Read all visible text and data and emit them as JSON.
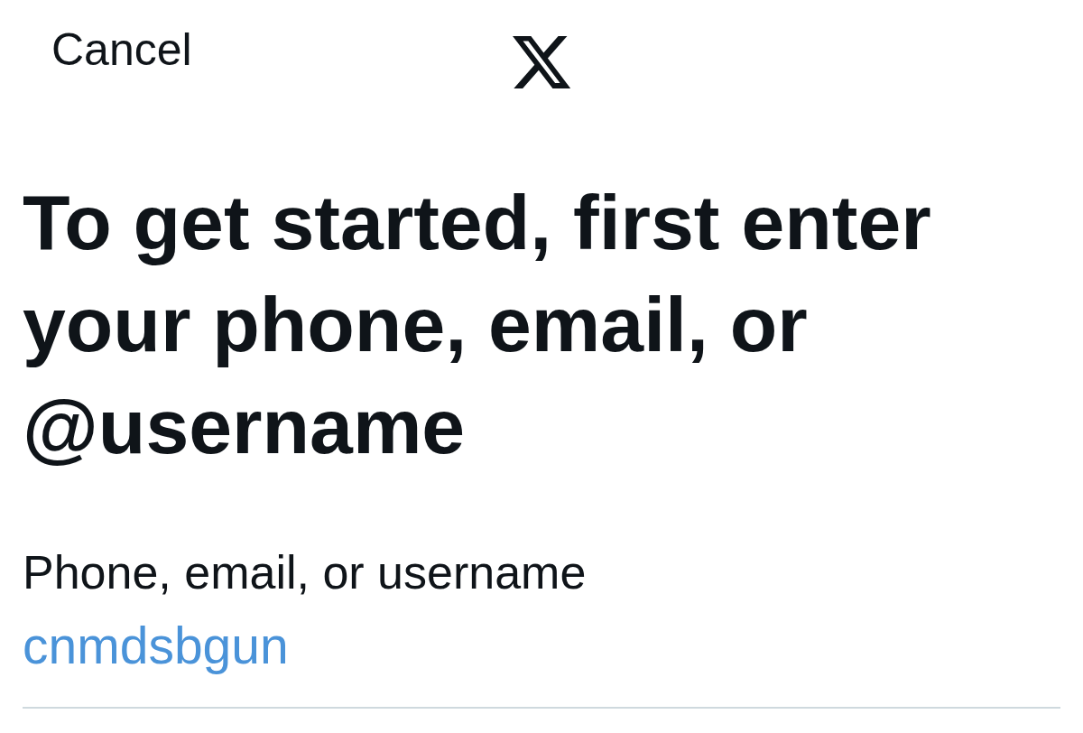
{
  "header": {
    "cancel": "Cancel"
  },
  "title": "To get started, first enter your phone, email, or @username",
  "field": {
    "label": "Phone, email, or username",
    "value": "cnmdsbgun"
  }
}
